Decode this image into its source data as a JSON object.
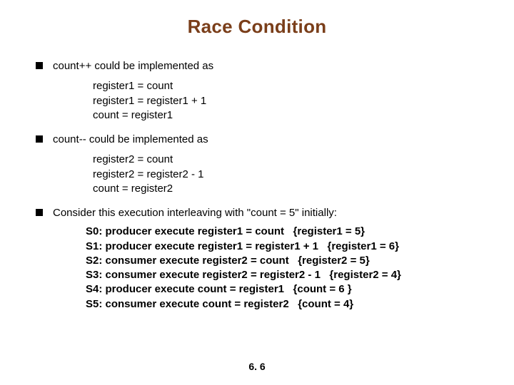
{
  "title": "Race Condition",
  "bullets": {
    "b1": "count++ could be implemented as",
    "b2": "count-- could be implemented as",
    "b3": "Consider this execution interleaving with \"count = 5\" initially:"
  },
  "code1": {
    "l1": "register1 = count",
    "l2": "register1 = register1 + 1",
    "l3": "count = register1"
  },
  "code2": {
    "l1": "register2 = count",
    "l2": "register2 = register2 - 1",
    "l3": "count = register2"
  },
  "interleave": {
    "s0": "S0: producer execute register1 = count   {register1 = 5}",
    "s1": "S1: producer execute register1 = register1 + 1   {register1 = 6}",
    "s2": "S2: consumer execute register2 = count   {register2 = 5}",
    "s3": "S3: consumer execute register2 = register2 - 1   {register2 = 4}",
    "s4": "S4: producer execute count = register1   {count = 6 }",
    "s5": "S5: consumer execute count = register2   {count = 4}"
  },
  "footer": "6. 6"
}
